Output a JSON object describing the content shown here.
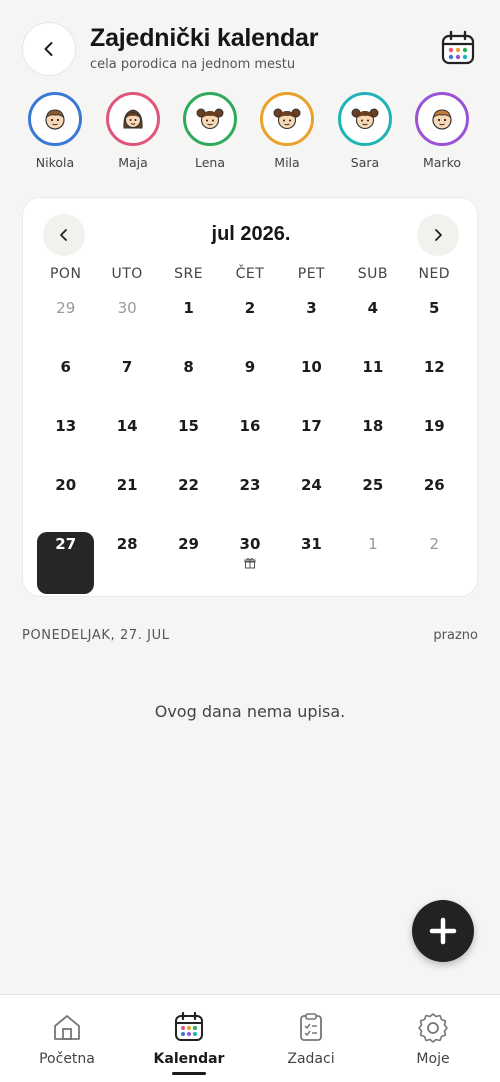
{
  "header": {
    "title": "Zajednički kalendar",
    "subtitle": "cela porodica na jednom mestu",
    "back_icon": "chevron-left-icon",
    "calendar_icon": "calendar-icon"
  },
  "members": [
    {
      "name": "Nikola",
      "color": "#3a78d6",
      "avatar": "boy-face-icon"
    },
    {
      "name": "Maja",
      "color": "#e0567a",
      "avatar": "woman-face-icon"
    },
    {
      "name": "Lena",
      "color": "#2faa5a",
      "avatar": "girl-pigtails-face-icon"
    },
    {
      "name": "Mila",
      "color": "#e8a12a",
      "avatar": "girl-pigtails-face-icon"
    },
    {
      "name": "Sara",
      "color": "#1fb3b5",
      "avatar": "girl-pigtails-face-icon"
    },
    {
      "name": "Marko",
      "color": "#9a52d6",
      "avatar": "boy-face-icon"
    }
  ],
  "calendar": {
    "month": "jul 2026.",
    "prev_icon": "chevron-left-icon",
    "next_icon": "chevron-right-icon",
    "weekdays": [
      "PON",
      "UTO",
      "SRE",
      "ČET",
      "PET",
      "SUB",
      "NED"
    ],
    "days": [
      {
        "label": "29",
        "muted": true
      },
      {
        "label": "30",
        "muted": true
      },
      {
        "label": "1"
      },
      {
        "label": "2"
      },
      {
        "label": "3"
      },
      {
        "label": "4"
      },
      {
        "label": "5"
      },
      {
        "label": "6"
      },
      {
        "label": "7"
      },
      {
        "label": "8"
      },
      {
        "label": "9"
      },
      {
        "label": "10"
      },
      {
        "label": "11"
      },
      {
        "label": "12"
      },
      {
        "label": "13"
      },
      {
        "label": "14"
      },
      {
        "label": "15"
      },
      {
        "label": "16"
      },
      {
        "label": "17"
      },
      {
        "label": "18"
      },
      {
        "label": "19"
      },
      {
        "label": "20"
      },
      {
        "label": "21"
      },
      {
        "label": "22"
      },
      {
        "label": "23"
      },
      {
        "label": "24"
      },
      {
        "label": "25"
      },
      {
        "label": "26"
      },
      {
        "label": "27",
        "selected": true
      },
      {
        "label": "28"
      },
      {
        "label": "29"
      },
      {
        "label": "30",
        "icon": "gift-icon"
      },
      {
        "label": "31"
      },
      {
        "label": "1",
        "muted": true
      },
      {
        "label": "2",
        "muted": true
      }
    ]
  },
  "selected_day": {
    "label": "PONEDELJAK, 27. JUL",
    "status": "prazno",
    "empty_message": "Ovog dana nema upisa."
  },
  "fab": {
    "icon": "plus-icon"
  },
  "bottom_nav": [
    {
      "label": "Početna",
      "icon": "home-icon",
      "active": false
    },
    {
      "label": "Kalendar",
      "icon": "calendar-icon",
      "active": true
    },
    {
      "label": "Zadaci",
      "icon": "clipboard-icon",
      "active": false
    },
    {
      "label": "Moje",
      "icon": "gear-icon",
      "active": false
    }
  ]
}
